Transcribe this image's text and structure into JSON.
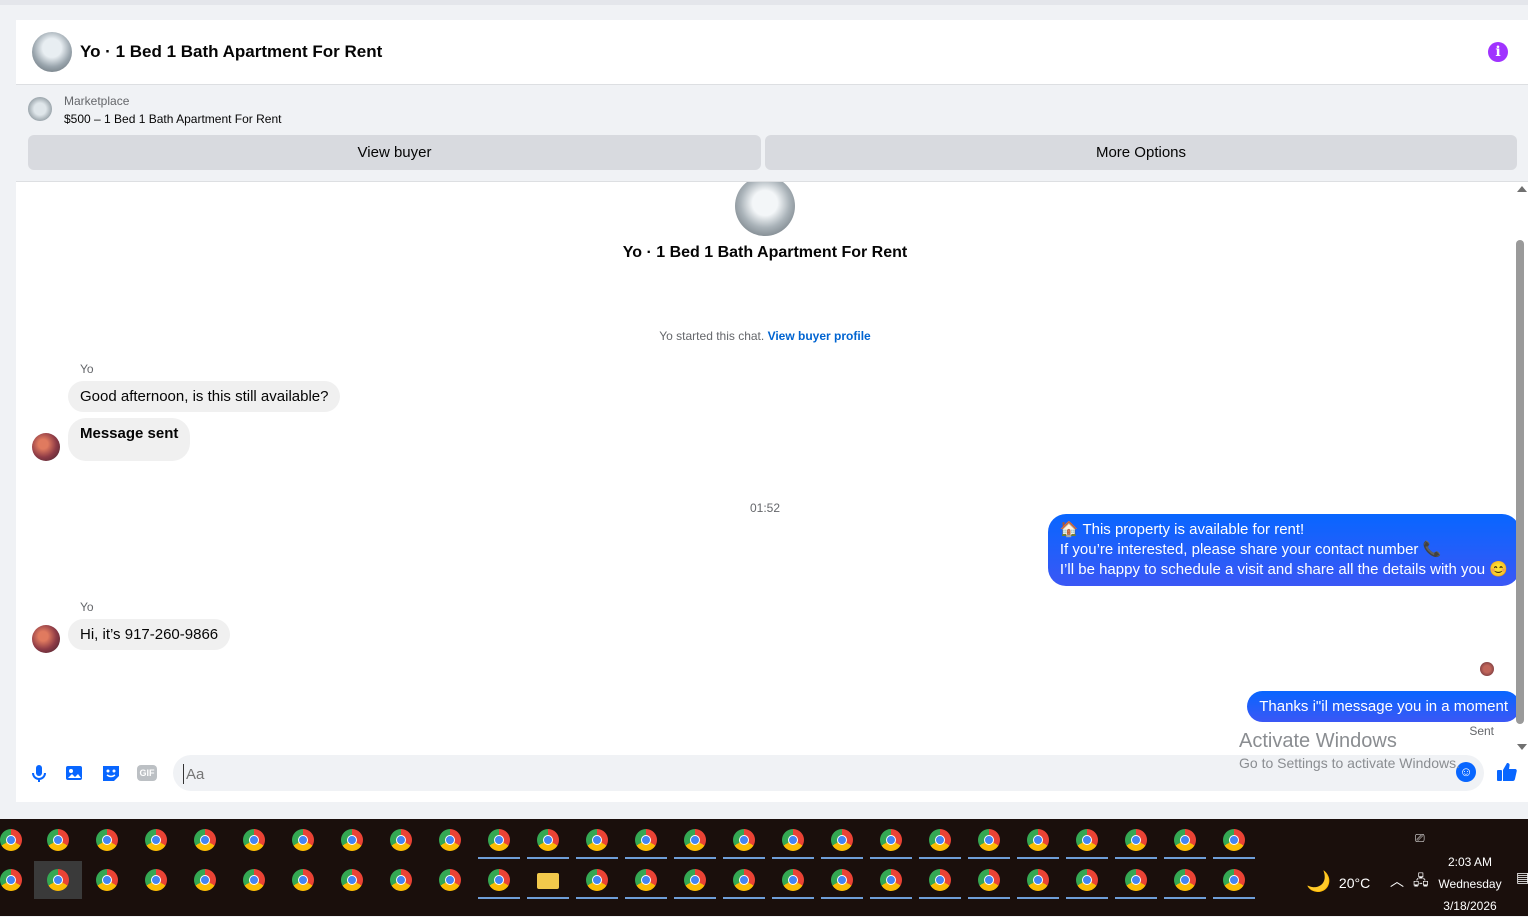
{
  "header": {
    "title": "Yo · 1 Bed 1 Bath Apartment For Rent",
    "info_icon": "info-icon",
    "info_glyph": "i"
  },
  "listing": {
    "label": "Marketplace",
    "price_title": "$500 – 1 Bed 1 Bath Apartment For Rent",
    "view_buyer": "View buyer",
    "more_options": "More Options"
  },
  "chat": {
    "title": "Yo · 1 Bed 1 Bath Apartment For Rent",
    "started_text": "Yo started this chat.",
    "started_link": "View buyer profile",
    "timestamp": "01:52",
    "messages": [
      {
        "sender": "Yo",
        "text": "Good afternoon, is this still available?"
      },
      {
        "text": "Message sent"
      },
      {
        "text_lines": [
          "🏠 This property is available for rent!",
          "If you’re interested, please share your contact number 📞",
          "I’ll be happy to schedule a visit and share all the details with you 😊"
        ]
      },
      {
        "sender": "Yo",
        "text": "Hi, it’s 917-260-9866"
      },
      {
        "text": "Thanks i\"il message you in a moment"
      }
    ],
    "status": "Sent"
  },
  "composer": {
    "placeholder": "Aa",
    "icons": [
      "microphone-icon",
      "image-icon",
      "sticker-icon",
      "gif-icon",
      "emoji-icon",
      "like-icon"
    ],
    "gif_label": "GIF"
  },
  "watermark": {
    "line1": "Activate Windows",
    "line2": "Go to Settings to activate Windows."
  },
  "taskbar": {
    "weather": "20°C",
    "time": "2:03 AM",
    "day": "Wednesday",
    "date": "3/18/2026"
  },
  "colors": {
    "accent": "#0866ff",
    "info": "#a033ff",
    "taskbar": "#1a0f0c"
  }
}
